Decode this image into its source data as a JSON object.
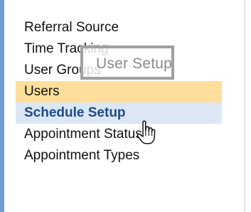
{
  "menu": {
    "items": [
      {
        "label": "Referral Source"
      },
      {
        "label": "Time Tracking"
      },
      {
        "label": "User Groups"
      },
      {
        "label": "Users"
      },
      {
        "label": "Schedule Setup"
      },
      {
        "label": "Appointment Status"
      },
      {
        "label": "Appointment Types"
      }
    ],
    "hovered_item": "Users",
    "active_item": "Schedule Setup"
  },
  "tooltip": {
    "text": "User Setup"
  },
  "colors": {
    "hover_highlight": "#fddf9b",
    "active_background": "#dbe7f5",
    "active_text": "#1f4a87",
    "left_accent": "#6f9bd6"
  },
  "cursor": {
    "icon": "hand-pointer-icon"
  }
}
